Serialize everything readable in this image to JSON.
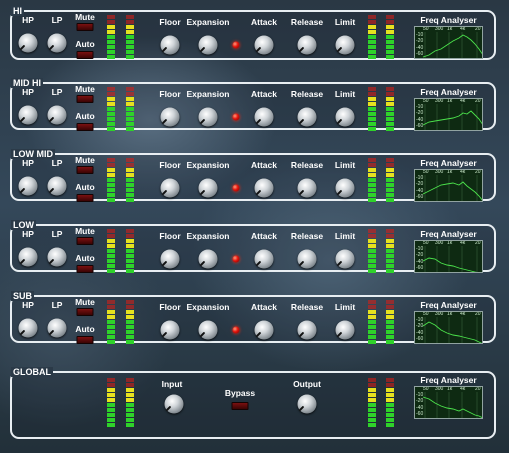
{
  "bands": [
    {
      "title": "HI",
      "controls": [
        "HP",
        "LP",
        "Mute",
        "Auto",
        "Floor",
        "Expansion",
        "Attack",
        "Release",
        "Limit"
      ]
    },
    {
      "title": "MID  HI",
      "controls": [
        "HP",
        "LP",
        "Mute",
        "Auto",
        "Floor",
        "Expansion",
        "Attack",
        "Release",
        "Limit"
      ]
    },
    {
      "title": "LOW MID",
      "controls": [
        "HP",
        "LP",
        "Mute",
        "Auto",
        "Floor",
        "Expansion",
        "Attack",
        "Release",
        "Limit"
      ]
    },
    {
      "title": "LOW",
      "controls": [
        "HP",
        "LP",
        "Mute",
        "Auto",
        "Floor",
        "Expansion",
        "Attack",
        "Release",
        "Limit"
      ]
    },
    {
      "title": "SUB",
      "controls": [
        "HP",
        "LP",
        "Mute",
        "Auto",
        "Floor",
        "Expansion",
        "Attack",
        "Release",
        "Limit"
      ]
    }
  ],
  "global": {
    "title": "GLOBAL",
    "input": "Input",
    "bypass": "Bypass",
    "output": "Output"
  },
  "freq_analyser": {
    "title": "Freq Analyser",
    "freq_ticks": [
      "50",
      "300",
      "1k",
      "4k",
      "20"
    ],
    "db_ticks": [
      "-10",
      "-20",
      "-40",
      "-60"
    ]
  },
  "colors": {
    "led": "#e3140d",
    "meter_green": "#2fd22a",
    "meter_yellow": "#e6e21f",
    "meter_red": "#e21b12",
    "frame": "#e8eef2",
    "analyser_bg": "#0e2a12",
    "analyser_line": "#4ce44c"
  },
  "icons": {
    "knob": "rotary-knob-icon",
    "led": "red-led-icon",
    "button": "red-push-button-icon"
  }
}
